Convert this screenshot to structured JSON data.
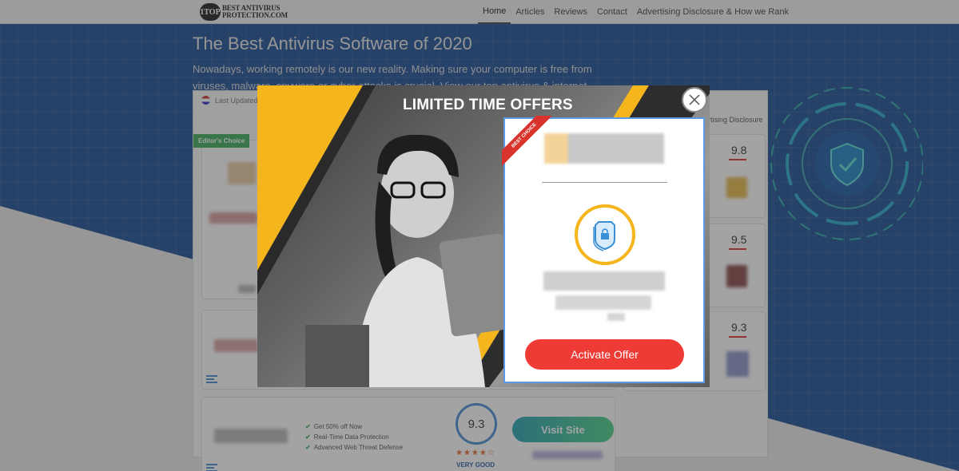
{
  "nav": {
    "logo_badge": "1TOP",
    "logo_line1": "BEST ANTIVIRUS",
    "logo_line2": "PROTECTION.COM",
    "links": [
      "Home",
      "Articles",
      "Reviews",
      "Contact",
      "Advertising Disclosure & How we Rank"
    ],
    "active": "Home"
  },
  "hero": {
    "title": "The Best Antivirus Software of 2020",
    "subtitle": "Nowadays, working remotely is our new reality. Making sure your computer is free from viruses, malware, spyware or cyber attacks is crucial. View our top antivirus & internet security softw"
  },
  "list": {
    "last_updated": "Last Updated:",
    "right_label": "rtising Disclosure",
    "editors_choice": "Editor's Choice"
  },
  "side_scores": [
    "9.8",
    "9.5",
    "9.3"
  ],
  "bottom_card": {
    "features": [
      "Get 50% off Now",
      "Real-Time Data Protection",
      "Advanced Web Threat Defense"
    ],
    "score": "9.3",
    "stars": "★★★★☆",
    "rating_label": "VERY GOOD",
    "visit_label": "Visit Site"
  },
  "modal": {
    "title": "LIMITED TIME OFFERS",
    "ribbon": "BEST CHOICE",
    "cta": "Activate Offer",
    "colors": {
      "accent_yellow": "#f5b51c",
      "cta_red": "#ef3b36",
      "card_border": "#5a9be8"
    }
  }
}
